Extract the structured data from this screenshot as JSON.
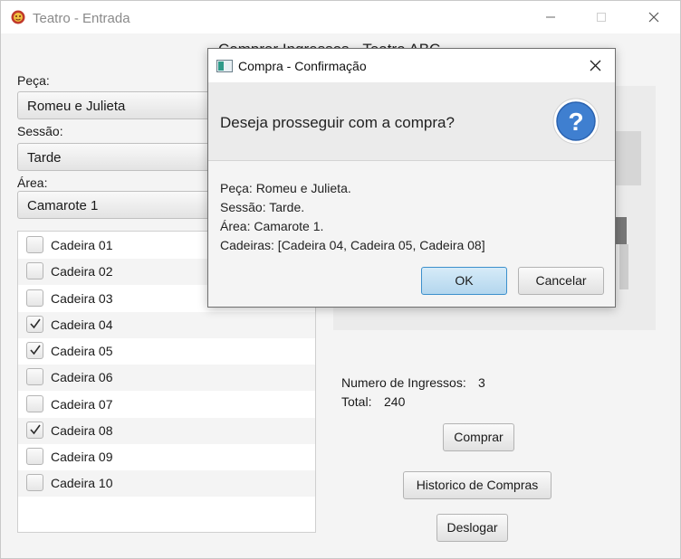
{
  "window": {
    "title": "Teatro - Entrada"
  },
  "page_heading": "Comprar Ingressos - Teatro ABC",
  "form": {
    "peca_label": "Peça:",
    "peca_value": "Romeu e Julieta",
    "sessao_label": "Sessão:",
    "sessao_value": "Tarde",
    "area_label": "Área:",
    "area_value": "Camarote 1"
  },
  "seats": [
    {
      "label": "Cadeira 01",
      "checked": false
    },
    {
      "label": "Cadeira 02",
      "checked": false
    },
    {
      "label": "Cadeira 03",
      "checked": false
    },
    {
      "label": "Cadeira 04",
      "checked": true
    },
    {
      "label": "Cadeira 05",
      "checked": true
    },
    {
      "label": "Cadeira 06",
      "checked": false
    },
    {
      "label": "Cadeira 07",
      "checked": false
    },
    {
      "label": "Cadeira 08",
      "checked": true
    },
    {
      "label": "Cadeira 09",
      "checked": false
    },
    {
      "label": "Cadeira 10",
      "checked": false
    }
  ],
  "summary": {
    "ingressos_label": "Numero de Ingressos:",
    "ingressos_value": "3",
    "total_label": "Total:",
    "total_value": "240"
  },
  "buttons": {
    "comprar": "Comprar",
    "historico": "Historico de Compras",
    "deslogar": "Deslogar"
  },
  "dialog": {
    "title": "Compra - Confirmação",
    "question": "Deseja prosseguir com a compra?",
    "lines": [
      "Peça: Romeu e Julieta.",
      "Sessão: Tarde.",
      "Área: Camarote 1.",
      "Cadeiras: [Cadeira 04, Cadeira 05, Cadeira 08]"
    ],
    "ok_label": "OK",
    "cancel_label": "Cancelar"
  },
  "colors": {
    "accent": "#3f7fd0",
    "ok_border": "#3c90cc",
    "ok_fill": "#bfdcf0"
  },
  "icons": [
    "theater-mask-icon",
    "minimize-icon",
    "maximize-icon",
    "close-icon",
    "window-icon",
    "question-icon",
    "checkmark-icon"
  ]
}
